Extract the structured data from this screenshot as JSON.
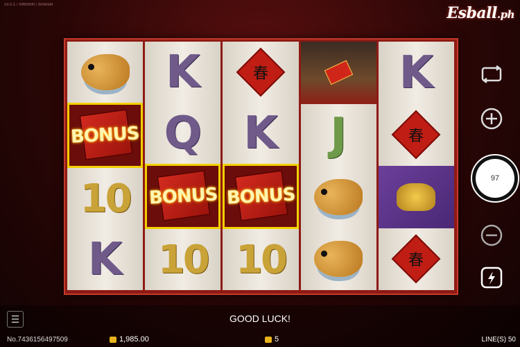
{
  "header": {
    "version": "v3.0.1 / v960900 / browser",
    "logo_main": "Esball",
    "logo_sub": ".ph"
  },
  "reels": [
    [
      {
        "type": "fish-symbol"
      },
      {
        "type": "bonus",
        "label": "BONUS",
        "highlight": true
      },
      {
        "type": "ten",
        "label": "10"
      },
      {
        "type": "letter",
        "label": "K"
      }
    ],
    [
      {
        "type": "letter",
        "label": "K"
      },
      {
        "type": "letter",
        "label": "Q"
      },
      {
        "type": "bonus",
        "label": "BONUS",
        "highlight": true
      },
      {
        "type": "ten",
        "label": "10"
      }
    ],
    [
      {
        "type": "fu",
        "label": "春"
      },
      {
        "type": "letter",
        "label": "K"
      },
      {
        "type": "bonus",
        "label": "BONUS",
        "highlight": true
      },
      {
        "type": "ten",
        "label": "10"
      }
    ],
    [
      {
        "type": "god"
      },
      {
        "type": "letter",
        "label": "J",
        "cls": "j"
      },
      {
        "type": "fish-symbol"
      },
      {
        "type": "fish-symbol"
      }
    ],
    [
      {
        "type": "letter",
        "label": "K"
      },
      {
        "type": "fu",
        "label": "春"
      },
      {
        "type": "ingot"
      },
      {
        "type": "fu",
        "label": "春"
      }
    ]
  ],
  "controls": {
    "spin_count": "97"
  },
  "footer": {
    "message": "GOOD LUCK!",
    "round_id": "No.7436156497509",
    "balance": "1,985.00",
    "bet": "5",
    "lines": "LINE(S) 50"
  },
  "colors": {
    "frame": "#8e1a14",
    "highlight": "#f2d000",
    "letter": "#6f5a8a",
    "gold": "#c9a238"
  }
}
